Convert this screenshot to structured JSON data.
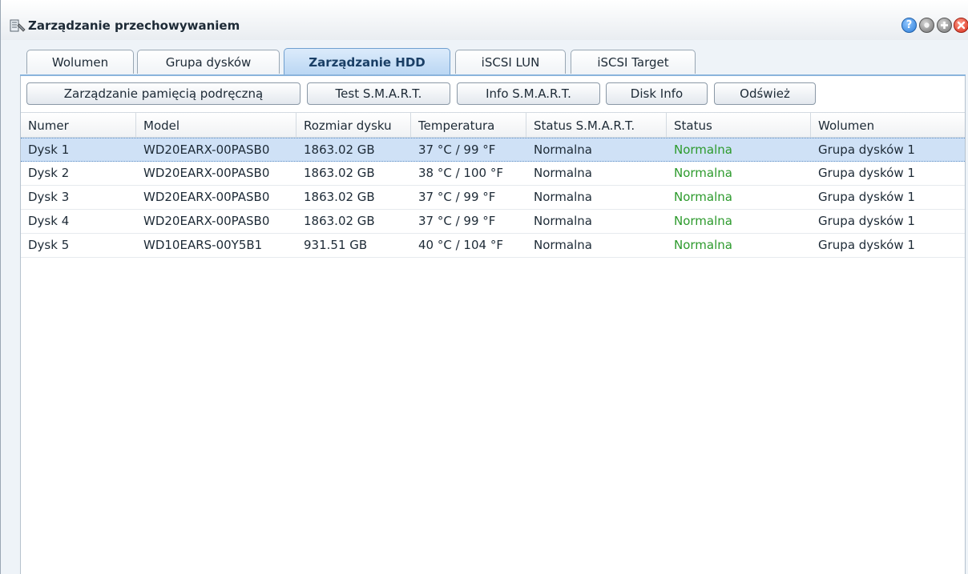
{
  "window": {
    "title": "Zarządzanie przechowywaniem"
  },
  "tabs": [
    {
      "label": "Wolumen",
      "active": false
    },
    {
      "label": "Grupa dysków",
      "active": false
    },
    {
      "label": "Zarządzanie HDD",
      "active": true
    },
    {
      "label": "iSCSI LUN",
      "active": false
    },
    {
      "label": "iSCSI Target",
      "active": false
    }
  ],
  "toolbar": {
    "cache": "Zarządzanie pamięcią podręczną",
    "smart_test": "Test S.M.A.R.T.",
    "smart_info": "Info S.M.A.R.T.",
    "disk_info": "Disk Info",
    "refresh": "Odśwież"
  },
  "table": {
    "columns": [
      "Numer",
      "Model",
      "Rozmiar dysku",
      "Temperatura",
      "Status S.M.A.R.T.",
      "Status",
      "Wolumen"
    ],
    "rows": [
      [
        "Dysk 1",
        "WD20EARX-00PASB0",
        "1863.02 GB",
        "37 °C / 99 °F",
        "Normalna",
        "Normalna",
        "Grupa dysków 1"
      ],
      [
        "Dysk 2",
        "WD20EARX-00PASB0",
        "1863.02 GB",
        "38 °C / 100 °F",
        "Normalna",
        "Normalna",
        "Grupa dysków 1"
      ],
      [
        "Dysk 3",
        "WD20EARX-00PASB0",
        "1863.02 GB",
        "37 °C / 99 °F",
        "Normalna",
        "Normalna",
        "Grupa dysków 1"
      ],
      [
        "Dysk 4",
        "WD20EARX-00PASB0",
        "1863.02 GB",
        "37 °C / 99 °F",
        "Normalna",
        "Normalna",
        "Grupa dysków 1"
      ],
      [
        "Dysk 5",
        "WD10EARS-00Y5B1",
        "931.51 GB",
        "40 °C / 104 °F",
        "Normalna",
        "Normalna",
        "Grupa dysków 1"
      ]
    ],
    "selected_row": 0
  },
  "colors": {
    "status_ok": "#2c9a2c",
    "selection": "#cfe1f6",
    "accent": "#8ab4dc"
  },
  "icons": {
    "app": "storage-manager-icon",
    "help": "help-icon",
    "minimize": "minimize-icon",
    "maximize": "maximize-icon",
    "close": "close-icon"
  }
}
